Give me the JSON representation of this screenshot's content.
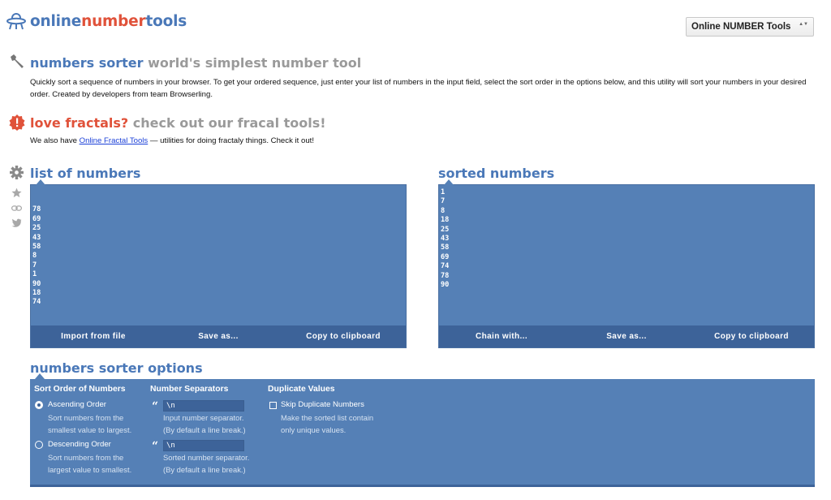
{
  "header": {
    "logo": {
      "part1": "online",
      "part2": "number",
      "part3": "tools"
    },
    "dropdown": {
      "selected": "Online NUMBER Tools",
      "arrow": "▲▼"
    }
  },
  "intro": {
    "title_main": "numbers sorter",
    "title_sub": "world's simplest number tool",
    "description": "Quickly sort a sequence of numbers in your browser. To get your ordered sequence, just enter your list of numbers in the input field, select the sort order in the options below, and this utility will sort your numbers in your desired order. Created by developers from team Browserling."
  },
  "promo": {
    "title_main": "love fractals?",
    "title_sub": "check out our fracal tools!",
    "text_before": "We also have ",
    "link": "Online Fractal Tools",
    "text_after": " — utilities for doing fractaly things. Check it out!"
  },
  "sidebar_icons": [
    "gear-icon",
    "star-icon",
    "link-icon",
    "twitter-icon"
  ],
  "input_panel": {
    "title": "list of numbers",
    "value": "\n78\n69\n25\n43\n58\n8\n7\n1\n90\n18\n74",
    "buttons": [
      "Import from file",
      "Save as...",
      "Copy to clipboard"
    ]
  },
  "output_panel": {
    "title": "sorted numbers",
    "value": "1\n7\n8\n18\n25\n43\n58\n69\n74\n78\n90",
    "buttons": [
      "Chain with...",
      "Save as...",
      "Copy to clipboard"
    ]
  },
  "options": {
    "title": "numbers sorter options",
    "sort_order": {
      "heading": "Sort Order of Numbers",
      "ascending": {
        "label": "Ascending Order",
        "desc1": "Sort numbers from the",
        "desc2": "smallest value to largest.",
        "selected": true
      },
      "descending": {
        "label": "Descending Order",
        "desc1": "Sort numbers from the",
        "desc2": "largest value to smallest.",
        "selected": false
      }
    },
    "separators": {
      "heading": "Number Separators",
      "input": {
        "value": "\\n",
        "desc1": "Input number separator.",
        "desc2": "(By default a line break.)"
      },
      "output": {
        "value": "\\n",
        "desc1": "Sorted number separator.",
        "desc2": "(By default a line break.)"
      }
    },
    "duplicates": {
      "heading": "Duplicate Values",
      "skip": {
        "label": "Skip Duplicate Numbers",
        "desc1": "Make the sorted list contain",
        "desc2": "only unique values.",
        "checked": false
      }
    }
  },
  "colors": {
    "panel": "#5580b6",
    "panel_bar": "#3d6399",
    "brand_blue": "#4a78b8",
    "brand_red": "#e0523a",
    "title_gray": "#9a9a9a"
  }
}
